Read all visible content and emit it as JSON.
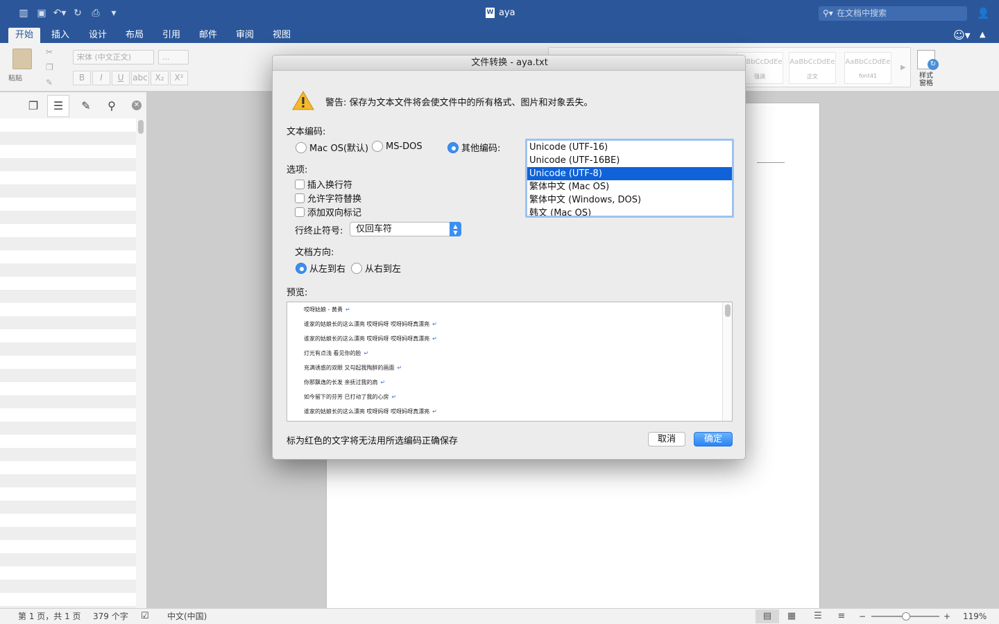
{
  "window": {
    "doc_title": "aya",
    "search_placeholder": "在文档中搜索"
  },
  "ribbon_tabs": [
    "开始",
    "插入",
    "设计",
    "布局",
    "引用",
    "邮件",
    "审阅",
    "视图"
  ],
  "ribbon": {
    "paste_label": "粘贴",
    "font_name": "宋体 (中文正文)",
    "font_size": "...",
    "style_previews": [
      {
        "sample": "AaBbCcDdEe",
        "name": "强调"
      },
      {
        "sample": "AaBbCcDdEe",
        "name": "正文"
      },
      {
        "sample": "AaBbCcDdEe",
        "name": "font41"
      }
    ],
    "styles_pane_label": "样式\n窗格"
  },
  "dialog": {
    "title": "文件转换 - aya.txt",
    "warning": "警告: 保存为文本文件将会使文件中的所有格式、图片和对象丢失。",
    "encoding_label": "文本编码:",
    "encoding_options": [
      "Mac OS(默认)",
      "MS-DOS",
      "其他编码:"
    ],
    "encoding_list": [
      "Unicode (UTF-16)",
      "Unicode (UTF-16BE)",
      "Unicode (UTF-8)",
      "繁体中文 (Mac OS)",
      "繁体中文 (Windows, DOS)",
      "韩文 (Mac OS)"
    ],
    "selected_encoding": "Unicode (UTF-8)",
    "options_label": "选项:",
    "checkboxes": [
      "插入换行符",
      "允许字符替换",
      "添加双向标记"
    ],
    "line_end_label": "行终止符号:",
    "line_end_value": "仅回车符",
    "direction_label": "文档方向:",
    "direction_options": [
      "从左到右",
      "从右到左"
    ],
    "preview_label": "预览:",
    "preview_lines": [
      "哎呀姑娘 - 黄勇",
      "谁家的姑娘长的这么漂亮 哎呀妈呀 哎呀妈呀真漂亮",
      "谁家的姑娘长的这么漂亮 哎呀妈呀 哎呀妈呀真漂亮",
      "灯光有点浅 看见你的脸",
      "充满诱惑的双眼 又勾起我陶醉的画面",
      "你那飘逸的长发 亲抚过我的肩",
      "如今留下的芬芳 已打动了我的心房",
      "谁家的姑娘长的这么漂亮 哎呀妈呀 哎呀妈呀真漂亮"
    ],
    "footer_note": "标为红色的文字将无法用所选编码正确保存",
    "cancel_label": "取消",
    "ok_label": "确定"
  },
  "statusbar": {
    "page_info": "第 1 页，共 1 页",
    "word_count": "379 个字",
    "language": "中文(中国)",
    "zoom": "119%"
  }
}
